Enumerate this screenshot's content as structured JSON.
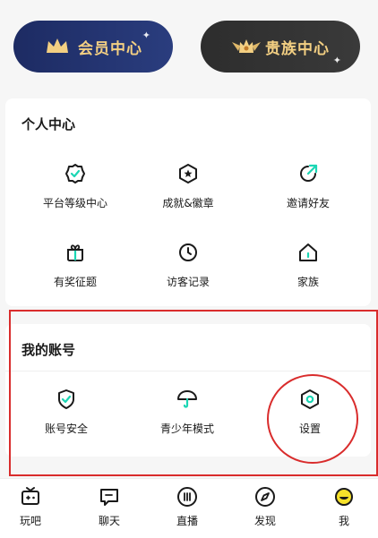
{
  "top": {
    "vip_label": "会员中心",
    "noble_label": "贵族中心"
  },
  "personal": {
    "title": "个人中心",
    "items": [
      {
        "label": "平台等级中心",
        "icon": "badge-check-icon"
      },
      {
        "label": "成就&徽章",
        "icon": "star-hexagon-icon"
      },
      {
        "label": "邀请好友",
        "icon": "share-arrow-icon"
      },
      {
        "label": "有奖征题",
        "icon": "gift-icon"
      },
      {
        "label": "访客记录",
        "icon": "clock-icon"
      },
      {
        "label": "家族",
        "icon": "home-icon"
      }
    ]
  },
  "account": {
    "title": "我的账号",
    "items": [
      {
        "label": "账号安全",
        "icon": "shield-check-icon"
      },
      {
        "label": "青少年模式",
        "icon": "umbrella-icon"
      },
      {
        "label": "设置",
        "icon": "gear-icon"
      }
    ]
  },
  "bottom_nav": {
    "items": [
      {
        "label": "玩吧",
        "icon": "game-icon"
      },
      {
        "label": "聊天",
        "icon": "chat-icon"
      },
      {
        "label": "直播",
        "icon": "live-icon"
      },
      {
        "label": "发现",
        "icon": "compass-icon"
      },
      {
        "label": "我",
        "icon": "smiley-icon"
      }
    ]
  },
  "colors": {
    "accent": "#1bd6b4",
    "highlight": "#d92c2c",
    "vip_bg": "#1d2b63",
    "gold": "#f3cf82"
  }
}
